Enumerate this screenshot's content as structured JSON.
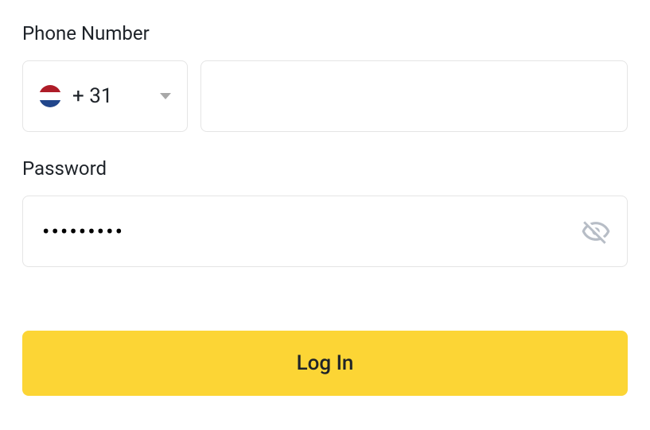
{
  "phone": {
    "label": "Phone Number",
    "country_code": "+ 31",
    "country": "netherlands",
    "value": ""
  },
  "password": {
    "label": "Password",
    "value": "•••••••••",
    "visible": false
  },
  "login": {
    "button_label": "Log In"
  },
  "colors": {
    "accent": "#fcd535",
    "text": "#1e2329",
    "border": "#e5e5e5"
  }
}
